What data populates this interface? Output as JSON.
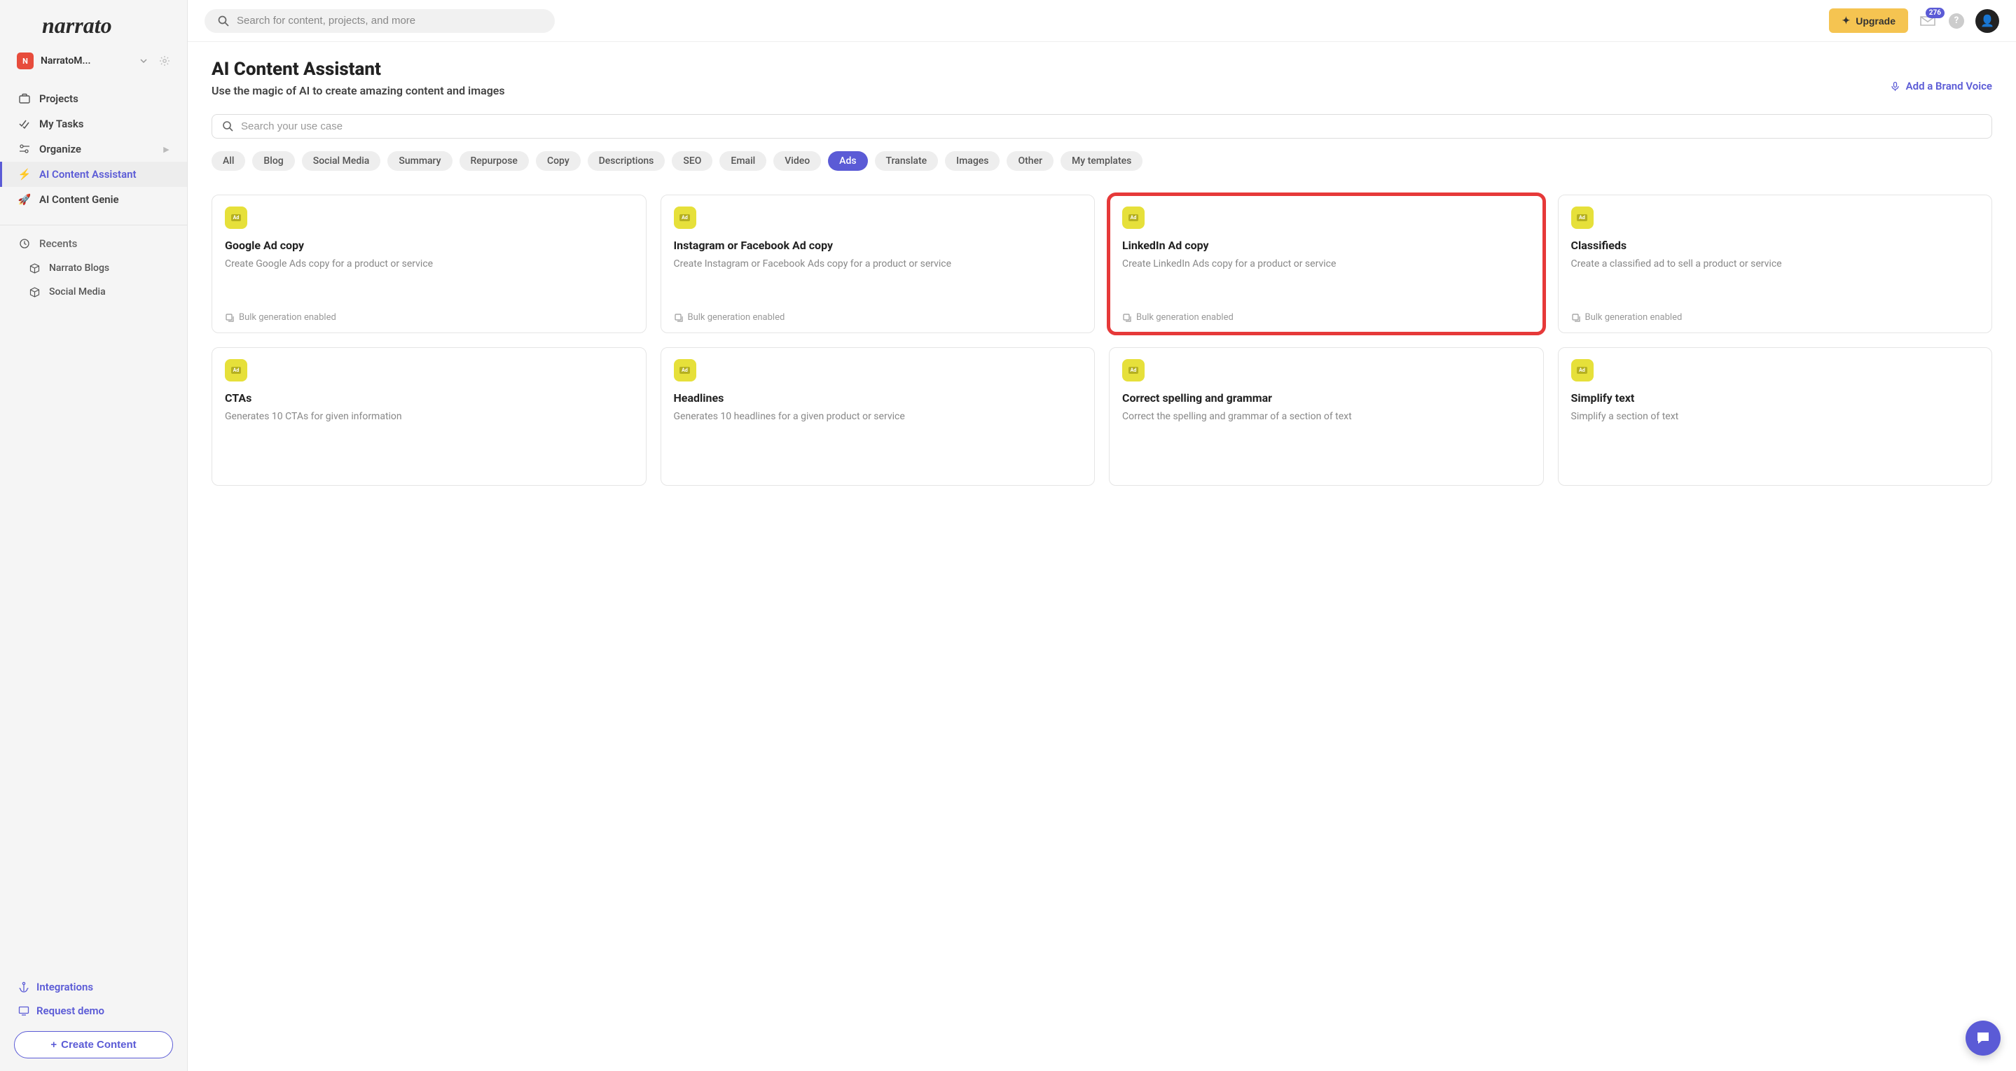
{
  "logo": "narrato",
  "workspace": {
    "badge": "N",
    "name": "NarratoM..."
  },
  "sidebar": {
    "projects": "Projects",
    "tasks": "My Tasks",
    "organize": "Organize",
    "assistant": "AI Content Assistant",
    "genie": "AI Content Genie",
    "recents": "Recents",
    "recent_items": [
      "Narrato Blogs",
      "Social Media"
    ],
    "integrations": "Integrations",
    "request_demo": "Request demo",
    "create": "Create Content"
  },
  "search_placeholder": "Search for content, projects, and more",
  "upgrade": "Upgrade",
  "notif_count": "276",
  "page": {
    "title": "AI Content Assistant",
    "subtitle": "Use the magic of AI to create amazing content and images",
    "brand_voice": "Add a Brand Voice",
    "usecase_placeholder": "Search your use case"
  },
  "chips": [
    "All",
    "Blog",
    "Social Media",
    "Summary",
    "Repurpose",
    "Copy",
    "Descriptions",
    "SEO",
    "Email",
    "Video",
    "Ads",
    "Translate",
    "Images",
    "Other",
    "My templates"
  ],
  "active_chip": "Ads",
  "bulk_label": "Bulk generation enabled",
  "cards": [
    {
      "title": "Google Ad copy",
      "desc": "Create Google Ads copy for a product or service",
      "bulk": true,
      "highlight": false
    },
    {
      "title": "Instagram or Facebook Ad copy",
      "desc": "Create Instagram or Facebook Ads copy for a product or service",
      "bulk": true,
      "highlight": false
    },
    {
      "title": "LinkedIn Ad copy",
      "desc": "Create LinkedIn Ads copy for a product or service",
      "bulk": true,
      "highlight": true
    },
    {
      "title": "Classifieds",
      "desc": "Create a classified ad to sell a product or service",
      "bulk": true,
      "highlight": false
    },
    {
      "title": "CTAs",
      "desc": "Generates 10 CTAs for given information",
      "bulk": false,
      "highlight": false
    },
    {
      "title": "Headlines",
      "desc": "Generates 10 headlines for a given product or service",
      "bulk": false,
      "highlight": false
    },
    {
      "title": "Correct spelling and grammar",
      "desc": "Correct the spelling and grammar of a section of text",
      "bulk": false,
      "highlight": false
    },
    {
      "title": "Simplify text",
      "desc": "Simplify a section of text",
      "bulk": false,
      "highlight": false
    }
  ]
}
